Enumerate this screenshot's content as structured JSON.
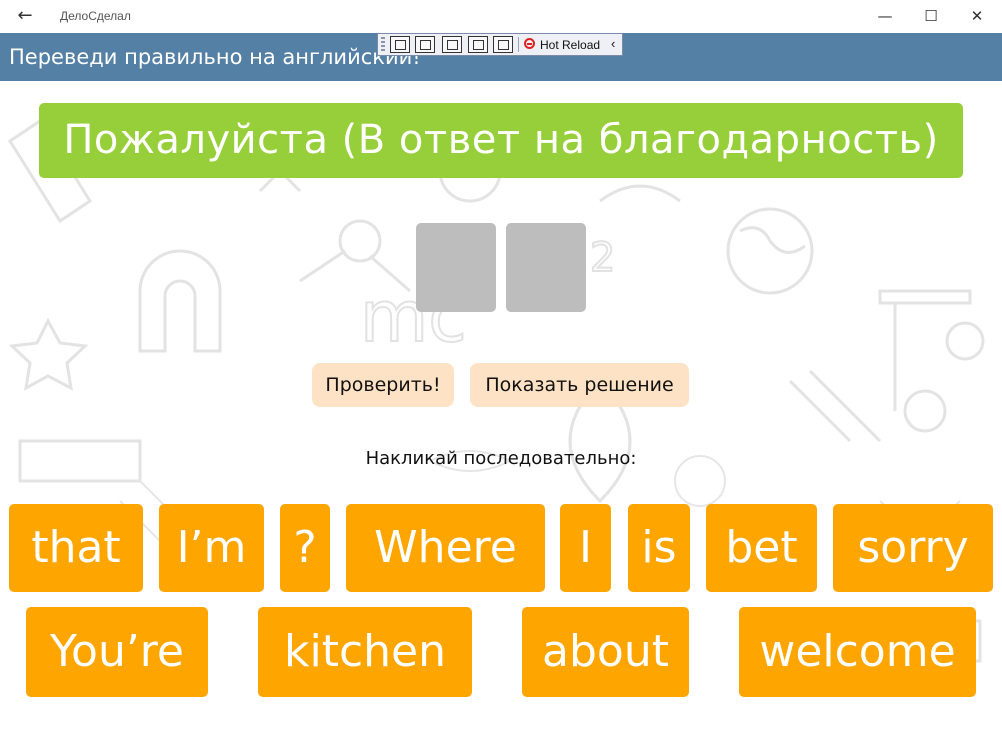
{
  "window": {
    "app_title": "ДелоСделал",
    "back_icon": "arrow-left-icon",
    "controls": {
      "minimize": "—",
      "maximize": "☐",
      "close": "✕"
    }
  },
  "header": {
    "text": "Переведи правильно на английский!"
  },
  "debug_toolbar": {
    "hot_reload_label": "Hot Reload",
    "collapse_glyph": "‹"
  },
  "prompt": {
    "text": "Пожалуйста (В ответ на благодарность)"
  },
  "answer": {
    "slots": [
      "",
      ""
    ]
  },
  "buttons": {
    "check": "Проверить!",
    "solution": "Показать решение"
  },
  "instructions": "Накликай последовательно:",
  "words_row1": [
    "that",
    "I’m",
    "?",
    "Where",
    "I",
    "is",
    "bet",
    "sorry"
  ],
  "words_row2": [
    "You’re",
    "kitchen",
    "about",
    "welcome"
  ],
  "colors": {
    "header": "#5580a6",
    "prompt_bg": "#97cf3a",
    "tile_bg": "#ffa500",
    "slot_bg": "#bdbdbd",
    "button_bg": "#fde2c5"
  }
}
